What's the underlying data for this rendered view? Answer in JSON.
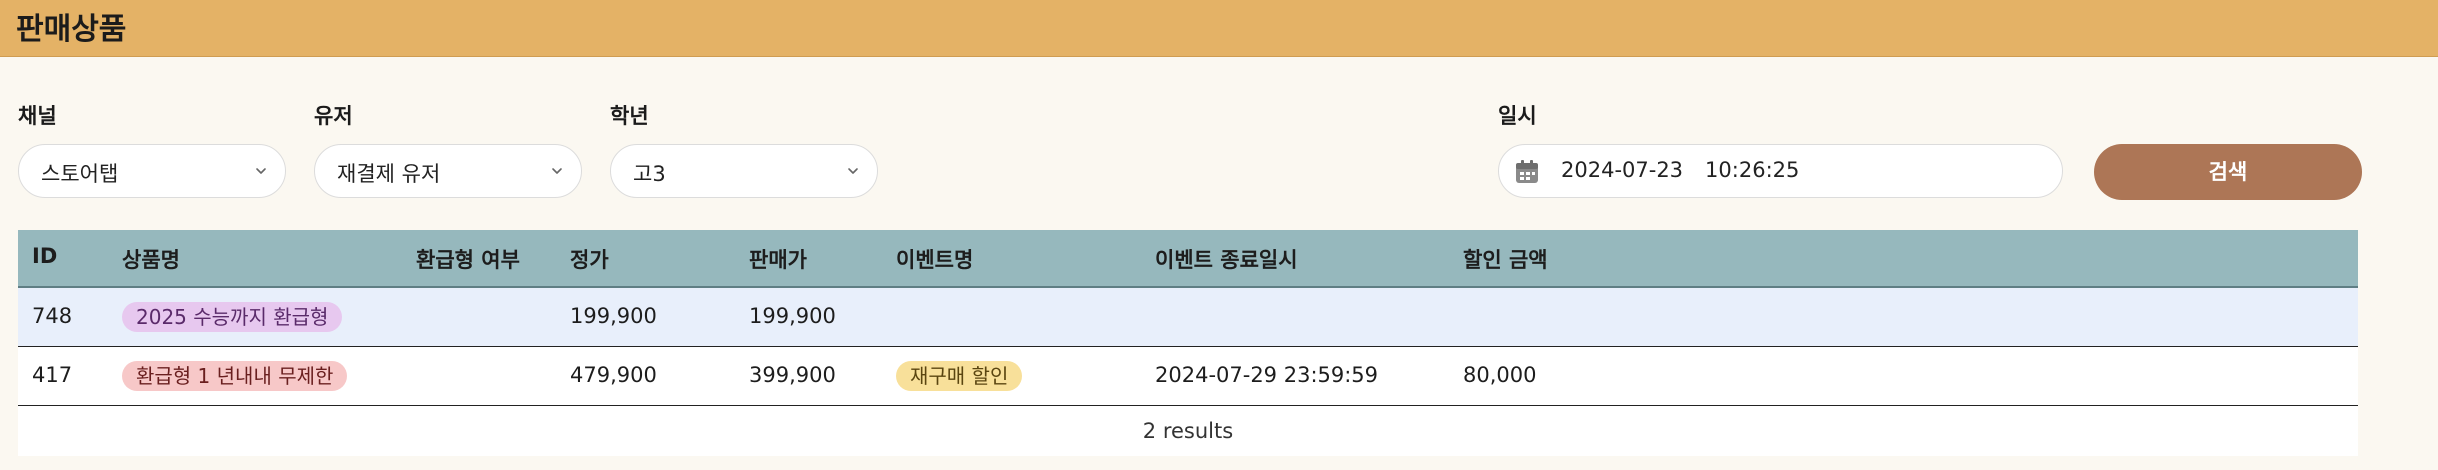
{
  "header": {
    "title": "판매상품"
  },
  "filters": {
    "channel": {
      "label": "채널",
      "value": "스토어탭"
    },
    "user": {
      "label": "유저",
      "value": "재결제 유저"
    },
    "grade": {
      "label": "학년",
      "value": "고3"
    },
    "datetime": {
      "label": "일시",
      "date": "2024-07-23",
      "time": "10:26:25"
    }
  },
  "search_label": "검색",
  "table": {
    "columns": [
      "ID",
      "상품명",
      "환급형 여부",
      "정가",
      "판매가",
      "이벤트명",
      "이벤트 종료일시",
      "할인 금액"
    ],
    "rows": [
      {
        "id": "748",
        "name": "2025 수능까지 환급형",
        "refundable": "",
        "list_price": "199,900",
        "sale_price": "199,900",
        "event": "",
        "event_end": "",
        "discount": ""
      },
      {
        "id": "417",
        "name": "환급형 1 년내내 무제한",
        "refundable": "",
        "list_price": "479,900",
        "sale_price": "399,900",
        "event": "재구매 할인",
        "event_end": "2024-07-29 23:59:59",
        "discount": "80,000"
      }
    ],
    "results": "2 results"
  }
}
